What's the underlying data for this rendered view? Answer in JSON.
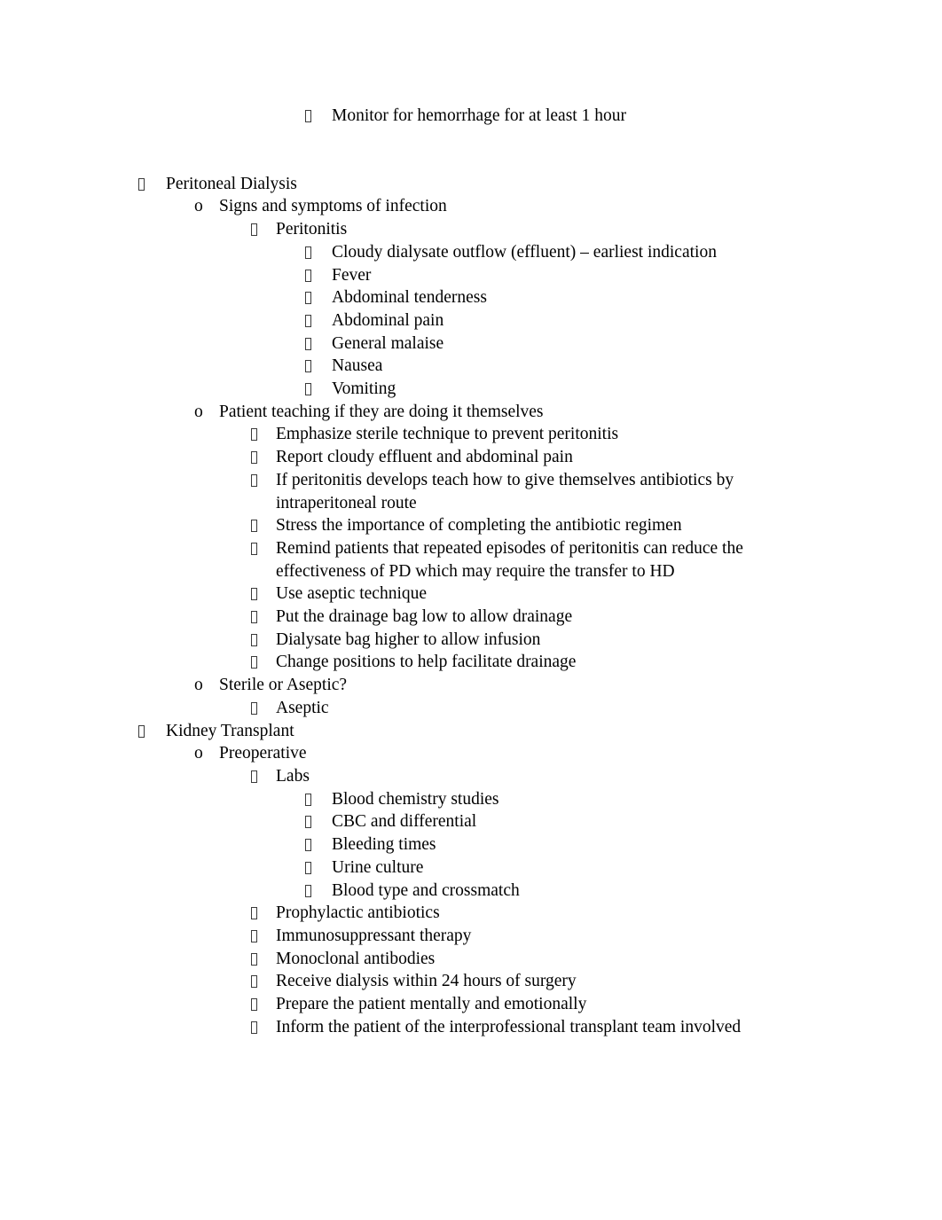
{
  "document": {
    "title": "Dialysis and Kidney Transplant Notes",
    "bullet_glyph": "missing-glyph-box",
    "ordered_marker": "o",
    "text_color": "#000000",
    "background_color": "#ffffff"
  },
  "outline": [
    {
      "level": 4,
      "marker": "box",
      "text": "Monitor for hemorrhage for at least 1 hour"
    },
    {
      "level": 0,
      "marker": "none",
      "text": ""
    },
    {
      "level": 1,
      "marker": "box",
      "text": "Peritoneal Dialysis"
    },
    {
      "level": 2,
      "marker": "o",
      "text": "Signs and symptoms of infection"
    },
    {
      "level": 3,
      "marker": "box",
      "text": "Peritonitis"
    },
    {
      "level": 4,
      "marker": "box",
      "text": "Cloudy dialysate outflow (effluent) – earliest indication"
    },
    {
      "level": 4,
      "marker": "box",
      "text": "Fever"
    },
    {
      "level": 4,
      "marker": "box",
      "text": "Abdominal tenderness"
    },
    {
      "level": 4,
      "marker": "box",
      "text": "Abdominal pain"
    },
    {
      "level": 4,
      "marker": "box",
      "text": "General malaise"
    },
    {
      "level": 4,
      "marker": "box",
      "text": "Nausea"
    },
    {
      "level": 4,
      "marker": "box",
      "text": "Vomiting"
    },
    {
      "level": 2,
      "marker": "o",
      "text": "Patient teaching if they are doing it themselves"
    },
    {
      "level": 3,
      "marker": "box",
      "text": "Emphasize sterile technique to prevent peritonitis"
    },
    {
      "level": 3,
      "marker": "box",
      "text": "Report cloudy effluent and abdominal pain"
    },
    {
      "level": 3,
      "marker": "box",
      "text": "If peritonitis develops teach how to give themselves antibiotics by intraperitoneal route"
    },
    {
      "level": 3,
      "marker": "box",
      "text": "Stress the importance of completing the antibiotic regimen"
    },
    {
      "level": 3,
      "marker": "box",
      "text": "Remind patients that repeated episodes of peritonitis can reduce the effectiveness of PD which may require the transfer to HD"
    },
    {
      "level": 3,
      "marker": "box",
      "text": "Use aseptic technique"
    },
    {
      "level": 3,
      "marker": "box",
      "text": "Put the drainage bag low to allow drainage"
    },
    {
      "level": 3,
      "marker": "box",
      "text": "Dialysate bag higher to allow infusion"
    },
    {
      "level": 3,
      "marker": "box",
      "text": "Change positions to help facilitate drainage"
    },
    {
      "level": 2,
      "marker": "o",
      "text": "Sterile or Aseptic?"
    },
    {
      "level": 3,
      "marker": "box",
      "text": "Aseptic"
    },
    {
      "level": 1,
      "marker": "box",
      "text": "Kidney Transplant"
    },
    {
      "level": 2,
      "marker": "o",
      "text": "Preoperative"
    },
    {
      "level": 3,
      "marker": "box",
      "text": "Labs"
    },
    {
      "level": 4,
      "marker": "box",
      "text": "Blood chemistry studies"
    },
    {
      "level": 4,
      "marker": "box",
      "text": "CBC and differential"
    },
    {
      "level": 4,
      "marker": "box",
      "text": "Bleeding times"
    },
    {
      "level": 4,
      "marker": "box",
      "text": "Urine culture"
    },
    {
      "level": 4,
      "marker": "box",
      "text": "Blood type and crossmatch"
    },
    {
      "level": 3,
      "marker": "box",
      "text": "Prophylactic antibiotics"
    },
    {
      "level": 3,
      "marker": "box",
      "text": "Immunosuppressant therapy"
    },
    {
      "level": 3,
      "marker": "box",
      "text": "Monoclonal antibodies"
    },
    {
      "level": 3,
      "marker": "box",
      "text": "Receive dialysis within 24 hours of surgery"
    },
    {
      "level": 3,
      "marker": "box",
      "text": "Prepare the patient mentally and emotionally"
    },
    {
      "level": 3,
      "marker": "box",
      "text": "Inform the patient of the interprofessional transplant team involved"
    }
  ]
}
